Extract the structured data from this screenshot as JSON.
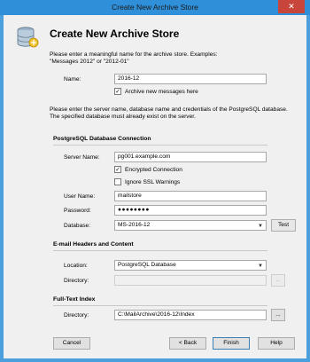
{
  "window": {
    "title": "Create New Archive Store",
    "close_glyph": "✕"
  },
  "header": {
    "heading": "Create New Archive Store",
    "icon": "database-icon"
  },
  "intro": {
    "line1": "Please enter a meaningful name for the archive store. Examples:",
    "line2": "\"Messages 2012\" or \"2012-01\""
  },
  "name": {
    "label": "Name:",
    "value": "2016-12",
    "archive_new_label": "Archive new messages here",
    "archive_new_checked": true
  },
  "server_intro": {
    "line1": "Please enter the server name, database name and credentials of the PostgreSQL database.",
    "line2": "The specified database must already exist on the server."
  },
  "postgres": {
    "section_title": "PostgreSQL Database Connection",
    "server_label": "Server Name:",
    "server_value": "pg001.example.com",
    "encrypted_label": "Encrypted Connection",
    "encrypted_checked": true,
    "ignore_ssl_label": "Ignore SSL Warnings",
    "ignore_ssl_checked": false,
    "user_label": "User Name:",
    "user_value": "mailstore",
    "password_label": "Password:",
    "password_value": "●●●●●●●●",
    "database_label": "Database:",
    "database_value": "MS-2016-12",
    "test_label": "Test"
  },
  "headers": {
    "section_title": "E-mail Headers and Content",
    "location_label": "Location:",
    "location_value": "PostgreSQL Database",
    "directory_label": "Directory:",
    "directory_value": "",
    "browse_label": "..."
  },
  "fulltext": {
    "section_title": "Full-Text Index",
    "directory_label": "Directory:",
    "directory_value": "C:\\MailArchive\\2016-12\\Index",
    "browse_label": "..."
  },
  "footer": {
    "cancel_label": "Cancel",
    "back_label": "< Back",
    "finish_label": "Finish",
    "help_label": "Help"
  }
}
